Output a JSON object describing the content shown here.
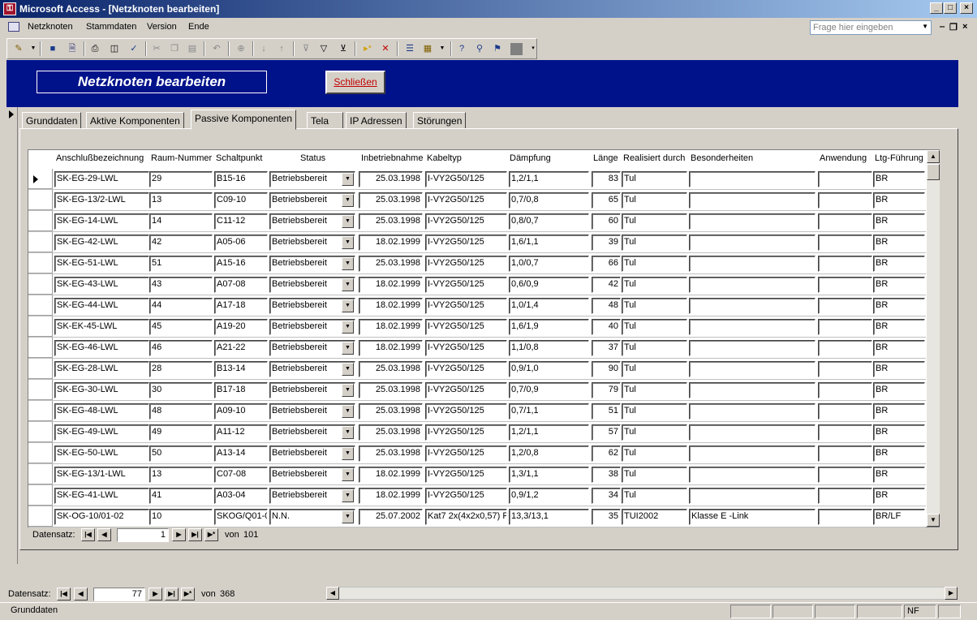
{
  "window": {
    "title": "Microsoft Access - [Netzknoten bearbeiten]",
    "icon": "access-key-icon"
  },
  "menu": {
    "items": [
      "Netzknoten",
      "Stammdaten",
      "Version",
      "Ende"
    ],
    "help_placeholder": "Frage hier eingeben"
  },
  "toolbar": {
    "icons": [
      "view-icon",
      "save-icon",
      "file-search-icon",
      "print-icon",
      "print-preview-icon",
      "spelling-icon",
      "cut-icon",
      "copy-icon",
      "paste-icon",
      "undo-icon",
      "hyperlink-icon",
      "sort-ascending-icon",
      "sort-descending-icon",
      "filter-by-selection-icon",
      "filter-by-form-icon",
      "apply-filter-icon",
      "new-record-icon",
      "delete-record-icon",
      "properties-icon",
      "database-window-icon",
      "new-object-icon",
      "help-icon",
      "find-icon",
      "binoculars-icon",
      "square-icon"
    ]
  },
  "form": {
    "title": "Netzknoten bearbeiten",
    "close_label": "Schließen"
  },
  "tabs": [
    {
      "label": "Grunddaten",
      "active": false
    },
    {
      "label": "Aktive Komponenten",
      "active": false
    },
    {
      "label": "Passive Komponenten",
      "active": true
    },
    {
      "label": "Tela",
      "active": false
    },
    {
      "label": "IP Adressen",
      "active": false
    },
    {
      "label": "Störungen",
      "active": false
    }
  ],
  "subform": {
    "columns": [
      "Anschlußbezeichnung",
      "Raum-Nummer",
      "Schaltpunkt",
      "Status",
      "Inbetriebnahme",
      "Kabeltyp",
      "Dämpfung",
      "Länge",
      "Realisiert durch",
      "Besonderheiten",
      "Anwendung",
      "Ltg-Führung"
    ],
    "rows": [
      [
        "SK-EG-29-LWL",
        "29",
        "B15-16",
        "Betriebsbereit",
        "25.03.1998",
        "I-VY2G50/125",
        "1,2/1,1",
        "83",
        "Tul",
        "",
        "",
        "BR"
      ],
      [
        "SK-EG-13/2-LWL",
        "13",
        "C09-10",
        "Betriebsbereit",
        "25.03.1998",
        "I-VY2G50/125",
        "0,7/0,8",
        "65",
        "Tul",
        "",
        "",
        "BR"
      ],
      [
        "SK-EG-14-LWL",
        "14",
        "C11-12",
        "Betriebsbereit",
        "25.03.1998",
        "I-VY2G50/125",
        "0,8/0,7",
        "60",
        "Tul",
        "",
        "",
        "BR"
      ],
      [
        "SK-EG-42-LWL",
        "42",
        "A05-06",
        "Betriebsbereit",
        "18.02.1999",
        "I-VY2G50/125",
        "1,6/1,1",
        "39",
        "Tul",
        "",
        "",
        "BR"
      ],
      [
        "SK-EG-51-LWL",
        "51",
        "A15-16",
        "Betriebsbereit",
        "25.03.1998",
        "I-VY2G50/125",
        "1,0/0,7",
        "66",
        "Tul",
        "",
        "",
        "BR"
      ],
      [
        "SK-EG-43-LWL",
        "43",
        "A07-08",
        "Betriebsbereit",
        "18.02.1999",
        "I-VY2G50/125",
        "0,6/0,9",
        "42",
        "Tul",
        "",
        "",
        "BR"
      ],
      [
        "SK-EG-44-LWL",
        "44",
        "A17-18",
        "Betriebsbereit",
        "18.02.1999",
        "I-VY2G50/125",
        "1,0/1,4",
        "48",
        "Tul",
        "",
        "",
        "BR"
      ],
      [
        "SK-EK-45-LWL",
        "45",
        "A19-20",
        "Betriebsbereit",
        "18.02.1999",
        "I-VY2G50/125",
        "1,6/1,9",
        "40",
        "Tul",
        "",
        "",
        "BR"
      ],
      [
        "SK-EG-46-LWL",
        "46",
        "A21-22",
        "Betriebsbereit",
        "18.02.1999",
        "I-VY2G50/125",
        "1,1/0,8",
        "37",
        "Tul",
        "",
        "",
        "BR"
      ],
      [
        "SK-EG-28-LWL",
        "28",
        "B13-14",
        "Betriebsbereit",
        "25.03.1998",
        "I-VY2G50/125",
        "0,9/1,0",
        "90",
        "Tul",
        "",
        "",
        "BR"
      ],
      [
        "SK-EG-30-LWL",
        "30",
        "B17-18",
        "Betriebsbereit",
        "25.03.1998",
        "I-VY2G50/125",
        "0,7/0,9",
        "79",
        "Tul",
        "",
        "",
        "BR"
      ],
      [
        "SK-EG-48-LWL",
        "48",
        "A09-10",
        "Betriebsbereit",
        "25.03.1998",
        "I-VY2G50/125",
        "0,7/1,1",
        "51",
        "Tul",
        "",
        "",
        "BR"
      ],
      [
        "SK-EG-49-LWL",
        "49",
        "A11-12",
        "Betriebsbereit",
        "25.03.1998",
        "I-VY2G50/125",
        "1,2/1,1",
        "57",
        "Tul",
        "",
        "",
        "BR"
      ],
      [
        "SK-EG-50-LWL",
        "50",
        "A13-14",
        "Betriebsbereit",
        "25.03.1998",
        "I-VY2G50/125",
        "1,2/0,8",
        "62",
        "Tul",
        "",
        "",
        "BR"
      ],
      [
        "SK-EG-13/1-LWL",
        "13",
        "C07-08",
        "Betriebsbereit",
        "18.02.1999",
        "I-VY2G50/125",
        "1,3/1,1",
        "38",
        "Tul",
        "",
        "",
        "BR"
      ],
      [
        "SK-EG-41-LWL",
        "41",
        "A03-04",
        "Betriebsbereit",
        "18.02.1999",
        "I-VY2G50/125",
        "0,9/1,2",
        "34",
        "Tul",
        "",
        "",
        "BR"
      ],
      [
        "SK-OG-10/01-02",
        "10",
        "SKOG/Q01-0",
        "N.N.",
        "25.07.2002",
        "Kat7 2x(4x2x0,57) F",
        "13,3/13,1",
        "35",
        "TUI2002",
        "Klasse E -Link",
        "",
        "BR/LF"
      ]
    ],
    "nav": {
      "label": "Datensatz:",
      "current": "1",
      "of_label": "von",
      "total": "101"
    }
  },
  "form_nav": {
    "label": "Datensatz:",
    "current": "77",
    "of_label": "von",
    "total": "368"
  },
  "status": {
    "text": "Grunddaten",
    "nf": "NF"
  }
}
